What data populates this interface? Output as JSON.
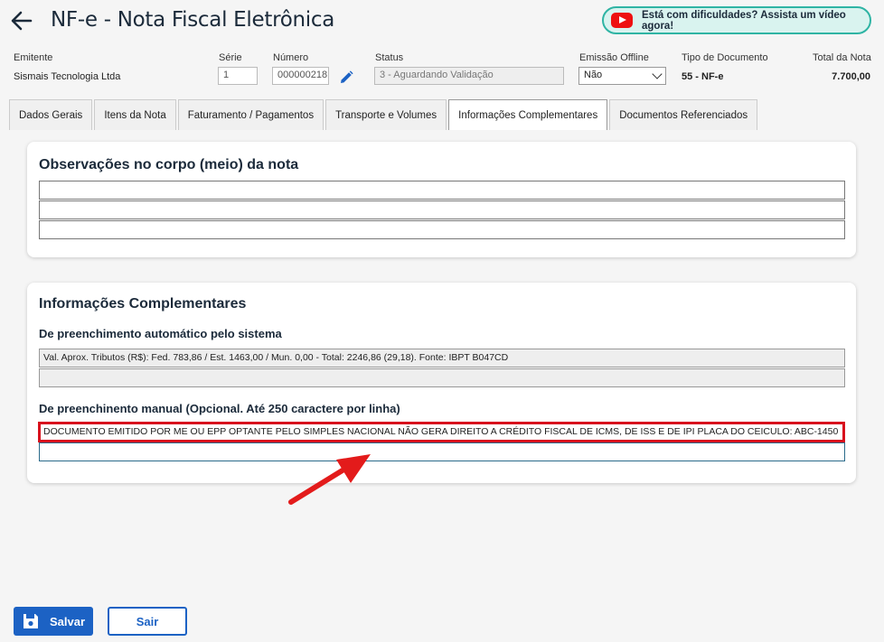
{
  "header": {
    "title": "NF-e - Nota Fiscal Eletrônica",
    "video_help": "Está com dificuldades? Assista um vídeo agora!"
  },
  "fields": {
    "emitente_label": "Emitente",
    "emitente_value": "Sismais Tecnologia Ltda",
    "serie_label": "Série",
    "serie_value": "1",
    "numero_label": "Número",
    "numero_value": "000000218",
    "status_label": "Status",
    "status_value": "3 - Aguardando Validação",
    "emissao_label": "Emissão Offline",
    "emissao_value": "Não",
    "tipo_label": "Tipo de Documento",
    "tipo_value": "55 - NF-e",
    "total_label": "Total da Nota",
    "total_value": "7.700,00"
  },
  "tabs": [
    {
      "label": "Dados Gerais"
    },
    {
      "label": "Itens da Nota"
    },
    {
      "label": "Faturamento / Pagamentos"
    },
    {
      "label": "Transporte e Volumes"
    },
    {
      "label": "Informações Complementares"
    },
    {
      "label": "Documentos Referenciados"
    }
  ],
  "observacoes": {
    "title": "Observações no corpo (meio) da nota",
    "lines": [
      "",
      "",
      ""
    ]
  },
  "info_comp": {
    "title": "Informações Complementares",
    "auto_title": "De preenchimento automático pelo sistema",
    "auto_lines": [
      "Val. Aprox. Tributos (R$): Fed. 783,86 / Est. 1463,00 / Mun. 0,00 - Total: 2246,86 (29,18). Fonte: IBPT B047CD",
      ""
    ],
    "manual_title": "De preenchinento manual (Opcional. Até 250 caractere por linha)",
    "manual_lines": [
      "DOCUMENTO EMITIDO POR ME OU EPP OPTANTE PELO SIMPLES NACIONAL NÃO GERA DIREITO A CRÉDITO FISCAL DE ICMS, DE ISS E DE IPI PLACA DO CEICULO: ABC-1450",
      ""
    ]
  },
  "actions": {
    "save_label": "Salvar",
    "exit_label": "Sair"
  },
  "colors": {
    "primary": "#1c62c4",
    "highlight": "#d8111d",
    "video_border": "#2fb4a4"
  }
}
